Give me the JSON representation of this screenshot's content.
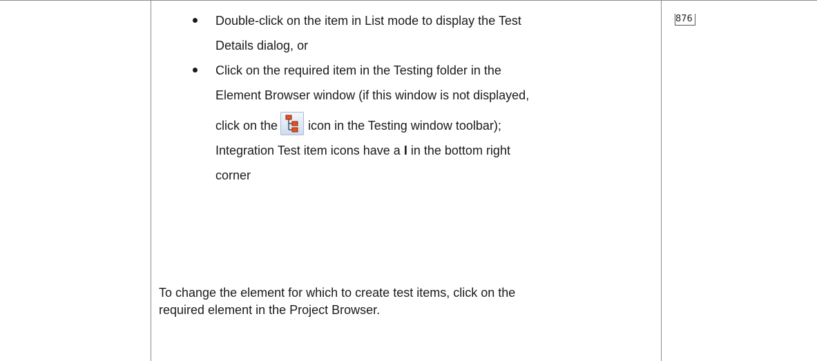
{
  "bullets": [
    {
      "line1": "Double-click on the item in List mode to display the Test",
      "line2": "Details dialog, or"
    },
    {
      "line1": "Click on the required item in the Testing folder in the",
      "line2": "Element Browser window (if this window is not displayed,",
      "line3_before_icon": "click on the",
      "line3_after_icon": "icon in the Testing window toolbar);",
      "line4_before_bold": "Integration Test item icons have a",
      "bold_letter": "I",
      "line4_after_bold": "in the bottom right",
      "line5": "corner"
    }
  ],
  "paragraph": {
    "line1": "To change the element for which to create test items, click on the",
    "line2": "required element in the Project Browser."
  },
  "page_reference": "876",
  "icons": {
    "toolbar_icon": "element-browser-tree-icon"
  }
}
